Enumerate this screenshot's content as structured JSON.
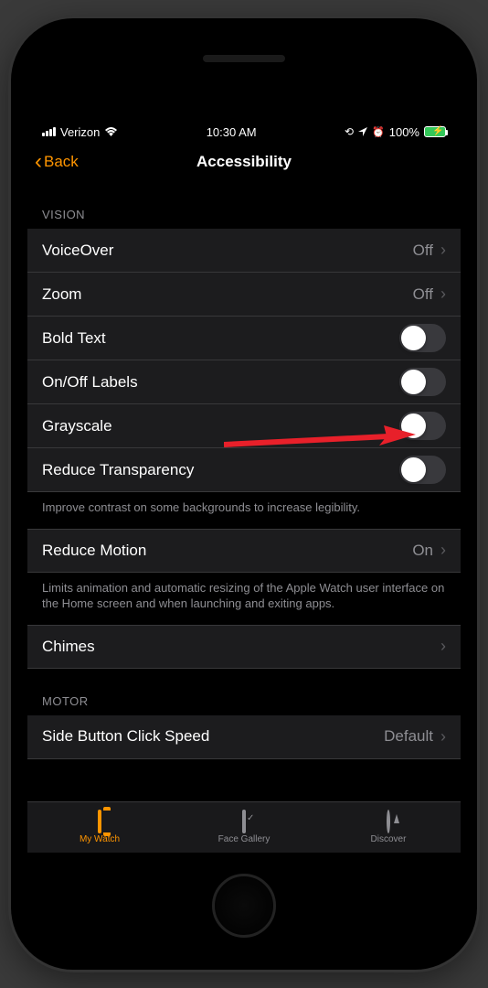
{
  "status": {
    "carrier": "Verizon",
    "time": "10:30 AM",
    "battery_pct": "100%"
  },
  "nav": {
    "back_label": "Back",
    "title": "Accessibility"
  },
  "sections": {
    "vision_header": "VISION",
    "motor_header": "MOTOR"
  },
  "rows": {
    "voiceover": {
      "label": "VoiceOver",
      "value": "Off"
    },
    "zoom": {
      "label": "Zoom",
      "value": "Off"
    },
    "bold_text": {
      "label": "Bold Text"
    },
    "onoff_labels": {
      "label": "On/Off Labels"
    },
    "grayscale": {
      "label": "Grayscale"
    },
    "reduce_transparency": {
      "label": "Reduce Transparency"
    },
    "reduce_motion": {
      "label": "Reduce Motion",
      "value": "On"
    },
    "chimes": {
      "label": "Chimes"
    },
    "side_button": {
      "label": "Side Button Click Speed",
      "value": "Default"
    }
  },
  "footers": {
    "transparency": "Improve contrast on some backgrounds to increase legibility.",
    "motion": "Limits animation and automatic resizing of the Apple Watch user interface on the Home screen and when launching and exiting apps."
  },
  "tabs": {
    "my_watch": "My Watch",
    "face_gallery": "Face Gallery",
    "discover": "Discover"
  }
}
